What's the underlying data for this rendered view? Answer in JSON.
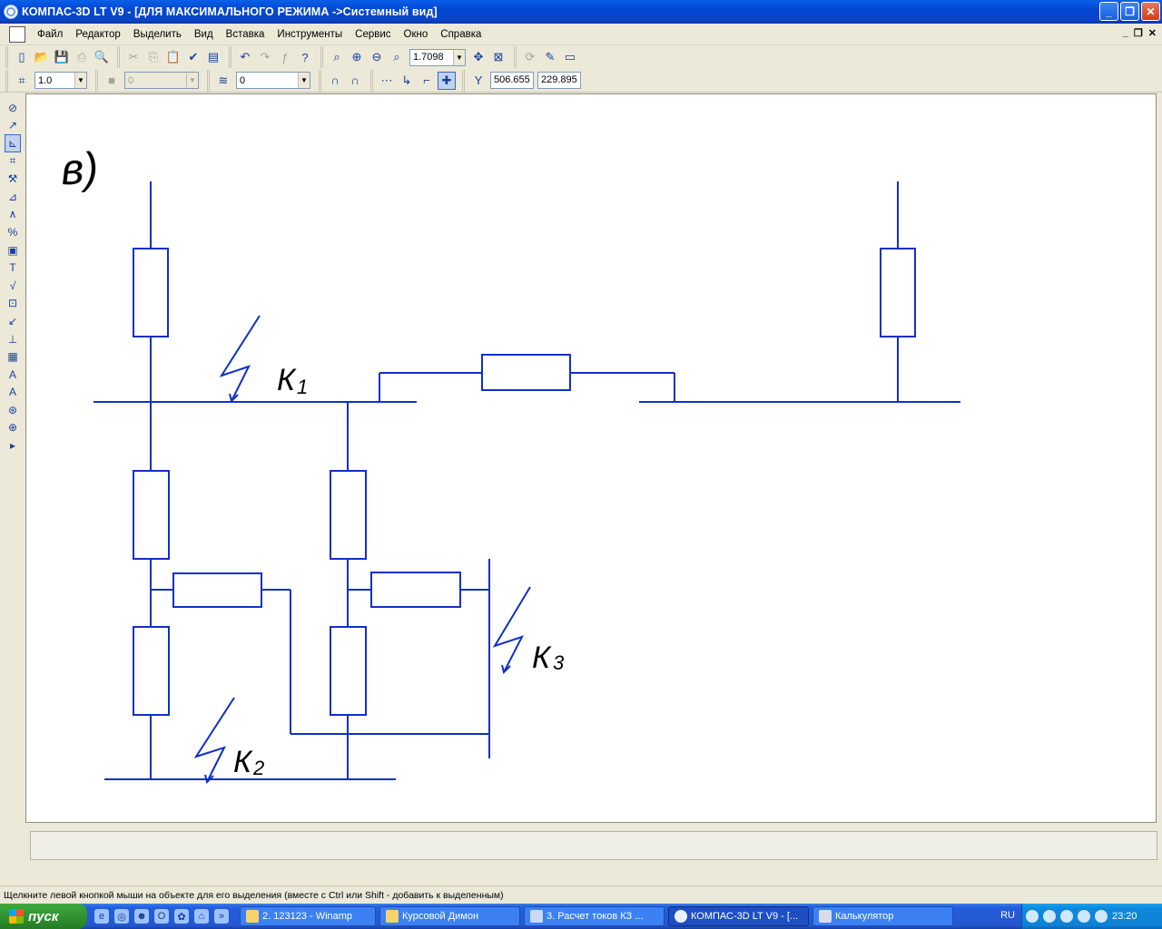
{
  "window": {
    "title": "КОМПАС-3D LT V9 - [ДЛЯ МАКСИМАЛЬНОГО РЕЖИМА ->Системный вид]"
  },
  "menu": [
    "Файл",
    "Редактор",
    "Выделить",
    "Вид",
    "Вставка",
    "Инструменты",
    "Сервис",
    "Окно",
    "Справка"
  ],
  "toolbar": {
    "zoom_value": "1.7098",
    "step_value": "1.0",
    "layer_state_value": "0",
    "layer_value": "0",
    "coord_x": "506.655",
    "coord_y": "229.895"
  },
  "drawing": {
    "variant_label": "в)",
    "faults": [
      {
        "letter": "К",
        "index": "1"
      },
      {
        "letter": "К",
        "index": "2"
      },
      {
        "letter": "К",
        "index": "3"
      }
    ],
    "line_color": "#1030c8"
  },
  "status": {
    "hint": "Щелкните левой кнопкой мыши на объекте для его выделения (вместе с Ctrl или Shift - добавить к выделенным)"
  },
  "taskbar": {
    "start_label": "пуск",
    "tasks": [
      "2. 123123 - Winamp",
      "Курсовой Димон",
      "3. Расчет токов КЗ ...",
      "КОМПАС-3D LT V9 - [...",
      "Калькулятор"
    ],
    "lang": "RU",
    "clock": "23:20"
  }
}
